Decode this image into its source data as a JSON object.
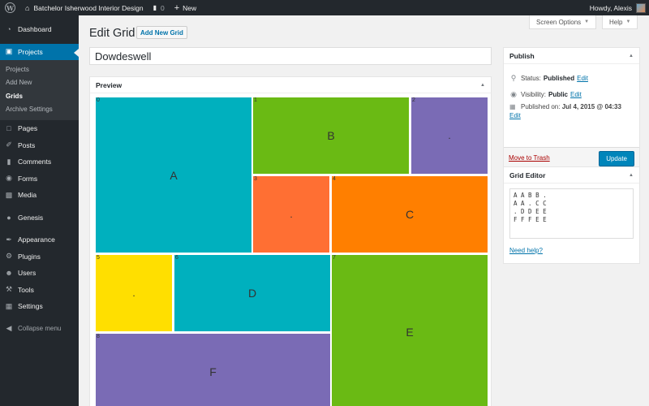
{
  "admin_bar": {
    "site_name": "Batchelor Isherwood Interior Design",
    "comments_count": "0",
    "new_label": "New",
    "greeting": "Howdy, Alexis"
  },
  "sidebar": {
    "items": [
      {
        "label": "Dashboard",
        "icon": "dashboard-icon"
      },
      {
        "label": "Projects",
        "icon": "projects-icon"
      },
      {
        "label": "Pages",
        "icon": "pages-icon"
      },
      {
        "label": "Posts",
        "icon": "posts-icon"
      },
      {
        "label": "Comments",
        "icon": "comments-icon"
      },
      {
        "label": "Forms",
        "icon": "forms-icon"
      },
      {
        "label": "Media",
        "icon": "media-icon"
      },
      {
        "label": "Genesis",
        "icon": "genesis-icon"
      },
      {
        "label": "Appearance",
        "icon": "appearance-icon"
      },
      {
        "label": "Plugins",
        "icon": "plugins-icon"
      },
      {
        "label": "Users",
        "icon": "users-icon"
      },
      {
        "label": "Tools",
        "icon": "tools-icon"
      },
      {
        "label": "Settings",
        "icon": "settings-icon"
      },
      {
        "label": "Collapse menu",
        "icon": "collapse-icon"
      }
    ],
    "submenu": [
      "Projects",
      "Add New",
      "Grids",
      "Archive Settings"
    ],
    "current_submenu": "Grids"
  },
  "header": {
    "title": "Edit Grid",
    "add_new_label": "Add New Grid",
    "screen_options_label": "Screen Options",
    "help_label": "Help"
  },
  "post_title": "Dowdeswell",
  "preview": {
    "title": "Preview",
    "cells": [
      {
        "index": "0",
        "label": "A",
        "color": "#00b0be"
      },
      {
        "index": "1",
        "label": "B",
        "color": "#6aba14"
      },
      {
        "index": "2",
        "label": ".",
        "color": "#7a6bb5"
      },
      {
        "index": "3",
        "label": ".",
        "color": "#ff6f33"
      },
      {
        "index": "4",
        "label": "C",
        "color": "#ff7f00"
      },
      {
        "index": "5",
        "label": ".",
        "color": "#ffdf00"
      },
      {
        "index": "6",
        "label": "D",
        "color": "#00b0be"
      },
      {
        "index": "7",
        "label": "E",
        "color": "#6aba14"
      },
      {
        "index": "8",
        "label": "F",
        "color": "#7a6bb5"
      }
    ]
  },
  "publish": {
    "title": "Publish",
    "status_label": "Status:",
    "status_value": "Published",
    "visibility_label": "Visibility:",
    "visibility_value": "Public",
    "published_label": "Published on:",
    "published_value": "Jul 4, 2015 @ 04:33",
    "edit_label": "Edit",
    "trash_label": "Move to Trash",
    "update_label": "Update"
  },
  "grid_editor": {
    "title": "Grid Editor",
    "value": "A A B B .\nA A . C C\n. D D E E\nF F F E E",
    "help_label": "Need help?"
  },
  "colors": {
    "admin_bg": "#23282d",
    "accent": "#0073aa",
    "page_bg": "#f1f1f1"
  }
}
